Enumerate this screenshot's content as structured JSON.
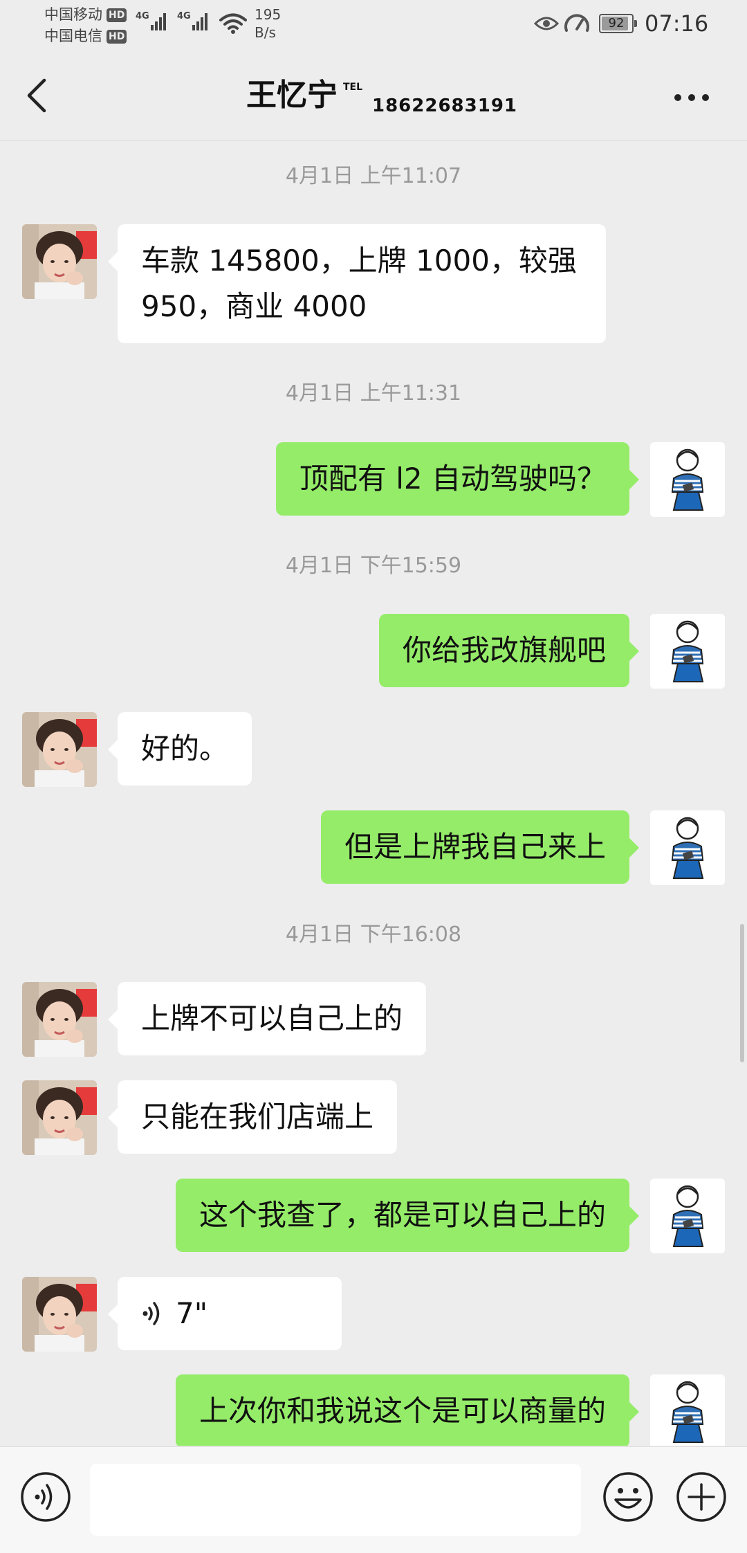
{
  "status_bar": {
    "carrier1": "中国移动",
    "carrier2": "中国电信",
    "hd_badge": "HD",
    "signal1_label": "4G",
    "signal2_label": "4G",
    "net_speed_value": "195",
    "net_speed_unit": "B/s",
    "battery": "92",
    "battery_level": 0.92,
    "time": "07:16"
  },
  "header": {
    "contact_name": "王忆宁",
    "tel_tag": "TEL",
    "phone": "18622683191"
  },
  "messages": [
    {
      "type": "time",
      "text": "4月1日 上午11:07"
    },
    {
      "type": "in",
      "text": "车款 145800，上牌 1000，较强 950，商业 4000"
    },
    {
      "type": "time",
      "text": "4月1日 上午11:31"
    },
    {
      "type": "out",
      "text": "顶配有 l2 自动驾驶吗？"
    },
    {
      "type": "time",
      "text": "4月1日 下午15:59"
    },
    {
      "type": "out",
      "text": "你给我改旗舰吧"
    },
    {
      "type": "in",
      "text": "好的。"
    },
    {
      "type": "out",
      "text": "但是上牌我自己来上"
    },
    {
      "type": "time",
      "text": "4月1日 下午16:08"
    },
    {
      "type": "in",
      "text": "上牌不可以自己上的"
    },
    {
      "type": "in",
      "text": "只能在我们店端上"
    },
    {
      "type": "out",
      "text": "这个我查了，都是可以自己上的"
    },
    {
      "type": "in_voice",
      "duration": "7\""
    },
    {
      "type": "out",
      "text": "上次你和我说这个是可以商量的"
    }
  ],
  "input": {
    "value": "",
    "placeholder": ""
  },
  "colors": {
    "background": "#ededed",
    "outgoing_bubble": "#95ec69",
    "incoming_bubble": "#ffffff",
    "timestamp_text": "#999999"
  }
}
